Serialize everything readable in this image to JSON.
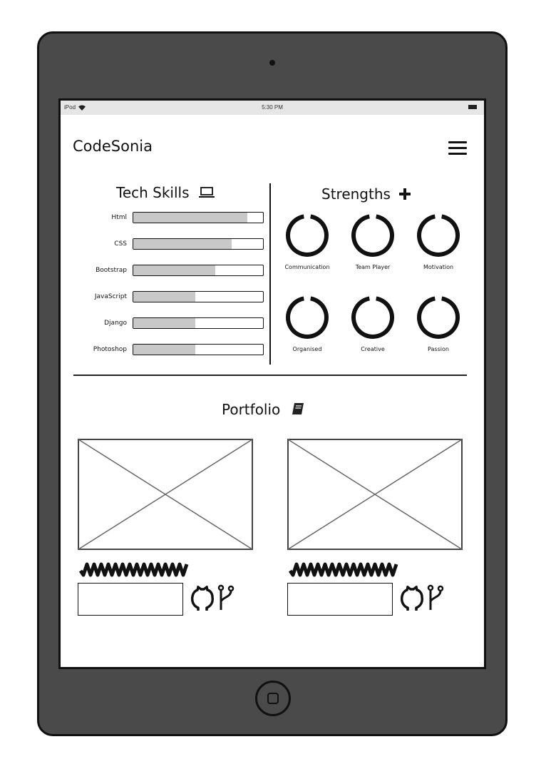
{
  "status_bar": {
    "carrier": "iPod",
    "time": "5:30 PM"
  },
  "header": {
    "brand": "CodeSonia",
    "menu_icon": "hamburger-menu-icon"
  },
  "tech_skills": {
    "title": "Tech Skills",
    "icon": "laptop-icon",
    "items": [
      {
        "label": "Html",
        "level": 0.88
      },
      {
        "label": "CSS",
        "level": 0.76
      },
      {
        "label": "Bootstrap",
        "level": 0.63
      },
      {
        "label": "JavaScript",
        "level": 0.48
      },
      {
        "label": "Django",
        "level": 0.48
      },
      {
        "label": "Photoshop",
        "level": 0.48
      }
    ]
  },
  "strengths": {
    "title": "Strengths",
    "icon": "plus-icon",
    "items": [
      {
        "label": "Communication"
      },
      {
        "label": "Team Player"
      },
      {
        "label": "Motivation"
      },
      {
        "label": "Organised"
      },
      {
        "label": "Creative"
      },
      {
        "label": "Passion"
      }
    ]
  },
  "portfolio": {
    "title": "Portfolio",
    "icon": "book-icon",
    "cards": [
      {
        "image": "image-placeholder",
        "icons": [
          "github-icon",
          "git-branch-icon"
        ]
      },
      {
        "image": "image-placeholder",
        "icons": [
          "github-icon",
          "git-branch-icon"
        ]
      }
    ]
  },
  "colors": {
    "device": "#4a4a4a",
    "bar_fill": "#c8c8c8",
    "status_bar": "#e6e6e6"
  }
}
